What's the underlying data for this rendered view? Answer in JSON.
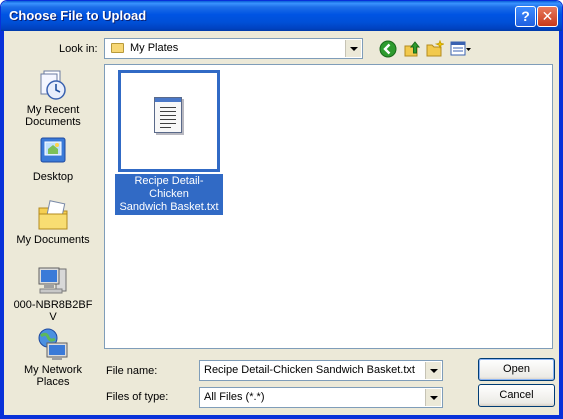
{
  "window": {
    "title": "Choose File to Upload",
    "help_label": "?",
    "close_label": "✕"
  },
  "toolbar": {
    "look_in_label": "Look in:",
    "look_in_value": "My Plates",
    "icons": [
      "back-icon",
      "up-folder-icon",
      "new-folder-icon",
      "view-menu-icon"
    ]
  },
  "places": [
    {
      "line1": "My Recent",
      "line2": "Documents",
      "icon": "recent-documents-icon"
    },
    {
      "line1": "Desktop",
      "line2": "",
      "icon": "desktop-icon"
    },
    {
      "line1": "My Documents",
      "line2": "",
      "icon": "my-documents-icon"
    },
    {
      "line1": "000-NBR8B2BF",
      "line2": "V",
      "icon": "my-computer-icon"
    },
    {
      "line1": "My Network",
      "line2": "Places",
      "icon": "network-places-icon"
    }
  ],
  "files": [
    {
      "line1": "Recipe Detail-Chicken",
      "line2": "Sandwich Basket.txt",
      "icon": "text-file-icon",
      "selected": true
    }
  ],
  "form": {
    "file_name_label": "File name:",
    "file_name_value": "Recipe Detail-Chicken Sandwich Basket.txt",
    "file_type_label": "Files of type:",
    "file_type_value": "All Files (*.*)"
  },
  "buttons": {
    "open": "Open",
    "cancel": "Cancel"
  },
  "colors": {
    "title_bar": "#0054e3",
    "selection": "#316ac5",
    "dialog_bg": "#ece9d8"
  }
}
